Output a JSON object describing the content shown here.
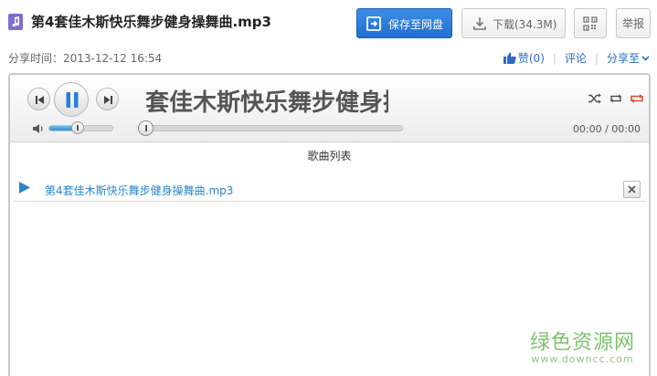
{
  "header": {
    "title": "第4套佳木斯快乐舞步健身操舞曲.mp3",
    "save_label": "保存至网盘",
    "download_label": "下载(34.3M)",
    "report_label": "举报"
  },
  "meta": {
    "share_time_label": "分享时间：",
    "share_time": "2013-12-12 16:54",
    "like_label": "赞",
    "like_count": "(0)",
    "comment_label": "评论",
    "share_to_label": "分享至"
  },
  "player": {
    "now_playing": "套佳木斯快乐舞步健身操舞曲",
    "time": "00:00 / 00:00",
    "volume_fraction": 0.45,
    "progress_fraction": 0.0,
    "playlist_title": "歌曲列表",
    "playlist": [
      {
        "name": "第4套佳木斯快乐舞步健身操舞曲.mp3"
      }
    ]
  },
  "watermark": {
    "text": "绿色资源网",
    "url": "www.downcc.com"
  },
  "colors": {
    "accent": "#1f6fd0",
    "link": "#2b6cc4",
    "playlist_link": "#2a87c8",
    "repeat_active": "#e04a3a",
    "watermark": "#7bc36a"
  }
}
